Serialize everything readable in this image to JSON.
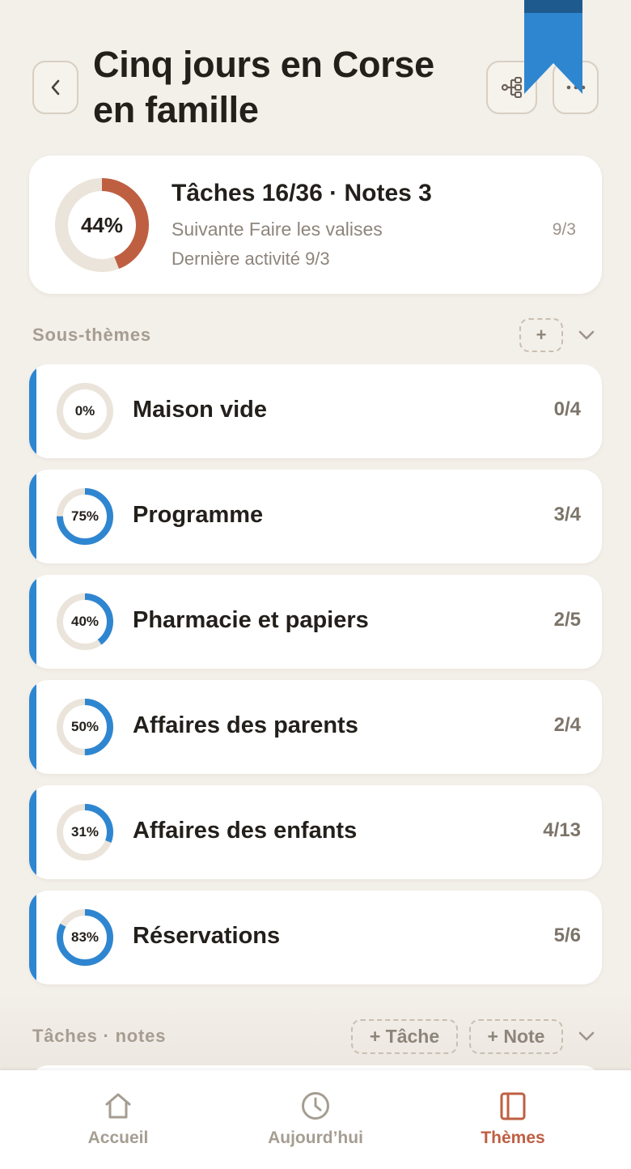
{
  "header": {
    "title_line1": "Cinq jours en Corse",
    "title_line2": "en famille",
    "back_icon": "chevron-left-icon",
    "tree_icon": "tree-structure-icon",
    "more_icon": "more-horizontal-icon",
    "bookmark_icon": "bookmark-ribbon-icon",
    "bookmark_color": "#2f86d0"
  },
  "summary": {
    "percent_label": "44%",
    "percent": 44,
    "ring_color": "#bf5f42",
    "title": "Tâches 16/36 · Notes 3",
    "next_text": "Suivante  Faire les valises",
    "next_date": "9/3",
    "activity": "Dernière activité 9/3"
  },
  "subthemes": {
    "label": "Sous-thèmes",
    "add_label": "+",
    "accent_color": "#2f86d0",
    "items": [
      {
        "name": "Maison vide",
        "percent_label": "0%",
        "percent": 0,
        "count": "0/4"
      },
      {
        "name": "Programme",
        "percent_label": "75%",
        "percent": 75,
        "count": "3/4"
      },
      {
        "name": "Pharmacie et papiers",
        "percent_label": "40%",
        "percent": 40,
        "count": "2/5"
      },
      {
        "name": "Affaires des parents",
        "percent_label": "50%",
        "percent": 50,
        "count": "2/4"
      },
      {
        "name": "Affaires des enfants",
        "percent_label": "31%",
        "percent": 31,
        "count": "4/13"
      },
      {
        "name": "Réservations",
        "percent_label": "83%",
        "percent": 83,
        "count": "5/6"
      }
    ]
  },
  "tasks": {
    "label": "Tâches · notes",
    "add_task": "+ Tâche",
    "add_note": "+ Note"
  },
  "nav": {
    "items": [
      {
        "label": "Accueil",
        "icon": "home-icon",
        "active": false
      },
      {
        "label": "Aujourd’hui",
        "icon": "clock-icon",
        "active": false
      },
      {
        "label": "Thèmes",
        "icon": "book-icon",
        "active": true
      }
    ],
    "active_color": "#bf5f42",
    "inactive_color": "#a69d92"
  }
}
